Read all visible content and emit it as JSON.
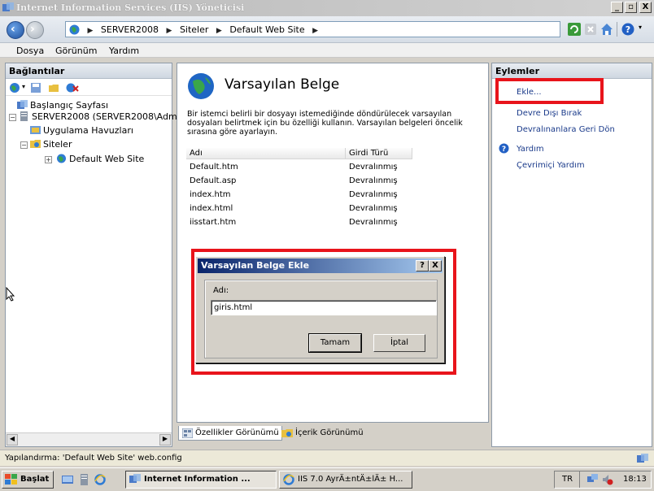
{
  "window": {
    "title": "Internet Information Services (IIS) Yöneticisi",
    "controls": [
      "_",
      "▫",
      "X"
    ]
  },
  "address": {
    "crumbs": [
      "SERVER2008",
      "Siteler",
      "Default Web Site"
    ]
  },
  "menu": {
    "items": [
      "Dosya",
      "Görünüm",
      "Yardım"
    ]
  },
  "connections": {
    "title": "Bağlantılar",
    "tree": [
      {
        "label": "Başlangıç Sayfası"
      },
      {
        "label": "SERVER2008 (SERVER2008\\Adm"
      },
      {
        "label": "Uygulama Havuzları"
      },
      {
        "label": "Siteler"
      },
      {
        "label": "Default Web Site"
      }
    ]
  },
  "feature": {
    "title": "Varsayılan Belge",
    "description": "Bir istemci belirli bir dosyayı istemediğinde döndürülecek varsayılan dosyaları belirtmek için bu özelliği kullanın. Varsayılan belgeleri öncelik sırasına göre ayarlayın.",
    "columns": [
      "Adı",
      "Girdi Türü"
    ],
    "rows": [
      {
        "name": "Default.htm",
        "type": "Devralınmış"
      },
      {
        "name": "Default.asp",
        "type": "Devralınmış"
      },
      {
        "name": "index.htm",
        "type": "Devralınmış"
      },
      {
        "name": "index.html",
        "type": "Devralınmış"
      },
      {
        "name": "iisstart.htm",
        "type": "Devralınmış"
      }
    ]
  },
  "view_tabs": {
    "features": "Özellikler Görünümü",
    "content": "İçerik Görünümü"
  },
  "actions": {
    "title": "Eylemler",
    "add": "Ekle...",
    "disable": "Devre Dışı Bırak",
    "revert": "Devralınanlara Geri Dön",
    "help": "Yardım",
    "online_help": "Çevrimiçi Yardım"
  },
  "dialog": {
    "title": "Varsayılan Belge Ekle",
    "help_btn": "?",
    "close_btn": "X",
    "label": "Adı:",
    "value": "giris.html",
    "ok": "Tamam",
    "cancel": "İptal"
  },
  "status": {
    "text": "Yapılandırma: 'Default Web Site' web.config"
  },
  "taskbar": {
    "start": "Başlat",
    "task1": "Internet Information ...",
    "task2": "IIS 7.0 AyrÄ±ntÄ±lÄ± H...",
    "lang": "TR",
    "clock": "18:13"
  },
  "colors": {
    "highlight_red": "#e8141b",
    "link_blue": "#1a3a8a",
    "dialog_title": "#0a246a"
  }
}
